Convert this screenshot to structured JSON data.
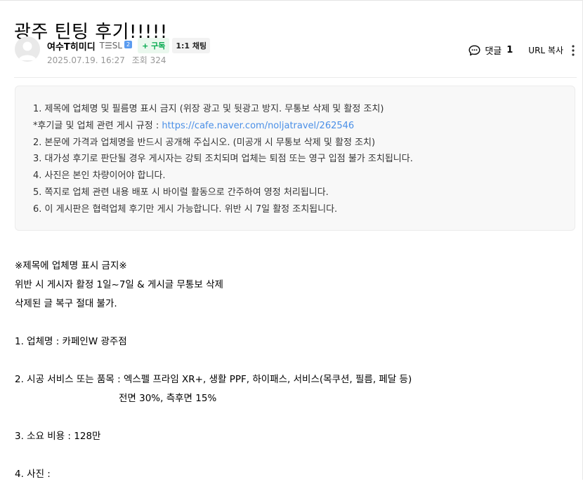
{
  "post": {
    "title": "광주 틴팅 후기!!!!!",
    "author": {
      "nickname": "여수T히미디",
      "grade": "T☰SL",
      "badge": "2",
      "subscribe_label": "+ 구독",
      "chat_label": "1:1 채팅"
    },
    "date": "2025.07.19. 16:27",
    "views_label": "조회 324"
  },
  "actions": {
    "comment_label": "댓글",
    "comment_count": "1",
    "copy_url_label": "URL 복사"
  },
  "notice": {
    "line1": "1. 제목에 업체명 및 필름명 표시 금지 (위장 광고 및 뒷광고 방지. 무통보 삭제 및 활정 조치)",
    "line2_prefix": "*후기글 및 업체 관련 게시 규정 : ",
    "line2_link": "https://cafe.naver.com/noljatravel/262546",
    "line3": "2. 본문에 가격과 업체명을 반드시 공개해 주십시오. (미공개 시 무통보 삭제 및 활정 조치)",
    "line4": "3. 대가성 후기로 판단될 경우 게시자는 강퇴 조치되며 업체는 퇴점 또는 영구 입점 불가 조치됩니다.",
    "line5": "4. 사진은 본인 차량이어야 합니다.",
    "line6": "5. 쪽지로 업체 관련 내용 배포 시 바이럴 활동으로 간주하여 영정 처리됩니다.",
    "line7": "6. 이 게시판은 협력업체 후기만 게시 가능합니다. 위반 시 7일 활정 조치됩니다."
  },
  "content": {
    "warning_title": "※제목에 업체명 표시 금지※",
    "warning_line1": "위반 시 게시자 활정 1일~7일 & 게시글 무통보 삭제",
    "warning_line2": "삭제된 글 복구 절대 불가.",
    "q1": "1. 업체명 :  카페인W 광주점",
    "q2": "2. 시공 서비스 또는 품목 :  엑스펠 프라임 XR+, 생활 PPF, 하이패스, 서비스(목쿠션, 필름, 페달 등)",
    "q2_cont": "전면 30%, 측후면 15%",
    "q3": "3. 소요 비용 :  128만",
    "q4": "4. 사진 :"
  }
}
